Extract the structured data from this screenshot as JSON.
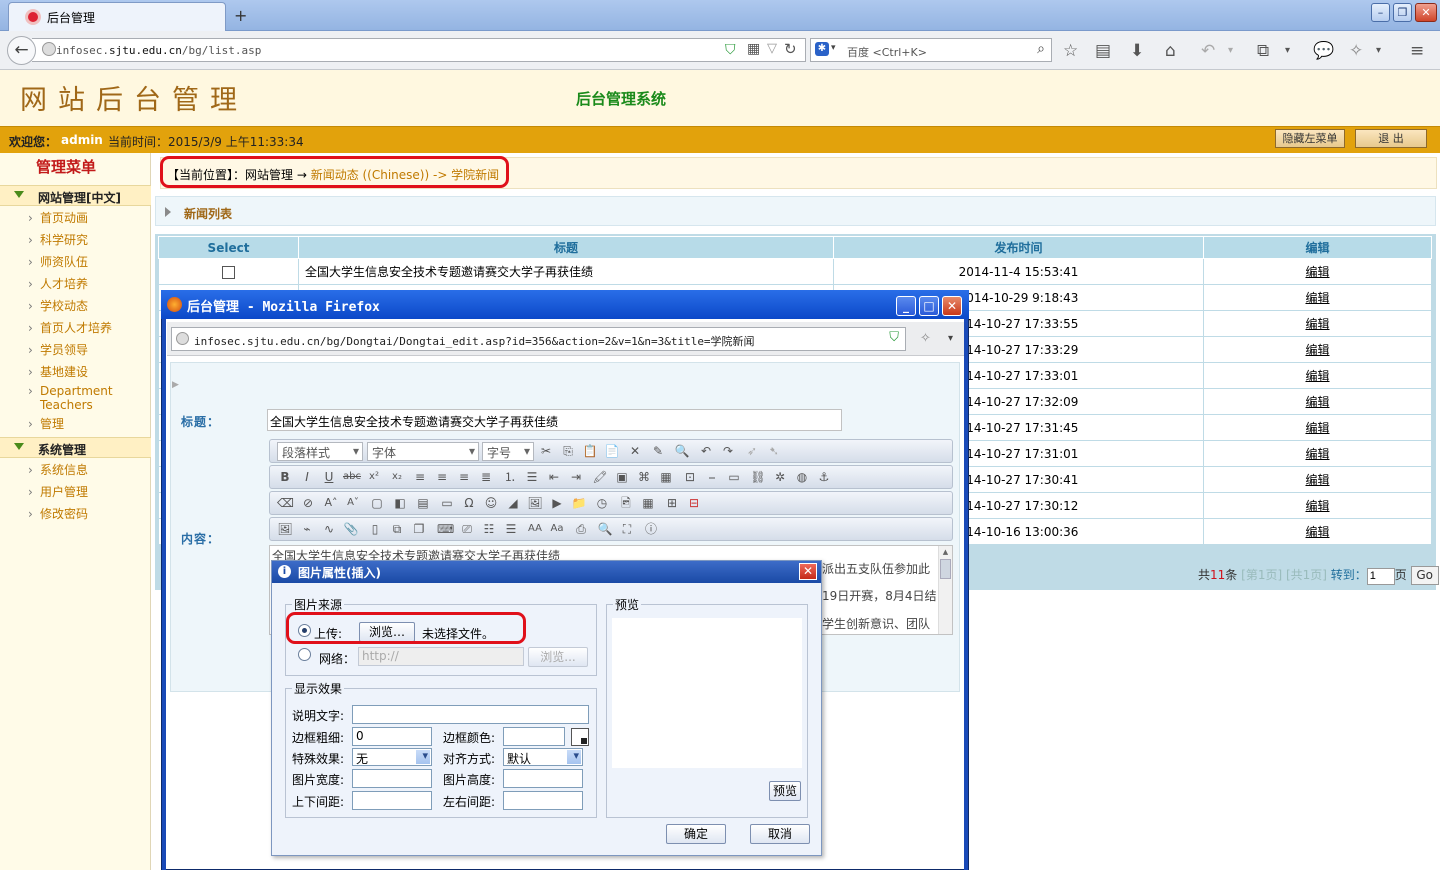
{
  "browser": {
    "tab_title": "后台管理",
    "new_tab_symbol": "+",
    "url_prefix": "infosec.",
    "url_domain": "sjtu.edu.cn",
    "url_path": "/bg/list.asp",
    "search_placeholder": "百度 <Ctrl+K>"
  },
  "header": {
    "site_title": "网站后台管理",
    "system_name": "后台管理系统"
  },
  "welcome": {
    "prefix": "欢迎您：",
    "user": "admin",
    "time_label": "当前时间：",
    "time": "2015/3/9 上午11:33:34",
    "hide_menu": "隐藏左菜单",
    "logout": "退 出"
  },
  "sidebar": {
    "title": "管理菜单",
    "section1": "网站管理[中文]",
    "items1": [
      "首页动画",
      "科学研究",
      "师资队伍",
      "人才培养",
      "学校动态",
      "首页人才培养",
      "学员领导",
      "基地建设"
    ],
    "dept_line1": "Department",
    "dept_line2": "Teachers",
    "item_manage": "管理",
    "section2": "系统管理",
    "items2": [
      "系统信息",
      "用户管理",
      "修改密码"
    ]
  },
  "breadcrumb": {
    "label": "【当前位置】：网站管理 → ",
    "path": "新闻动态 ((Chinese)) -> 学院新闻"
  },
  "list": {
    "bar_title": "新闻列表",
    "headers": [
      "Select",
      "标题",
      "发布时间",
      "编辑"
    ],
    "first_title": "全国大学生信息安全技术专题邀请赛交大学子再获佳绩",
    "first_time": "2014-11-4 15:53:41",
    "partial_times": [
      "2014-10-29 9:18:43",
      "014-10-27 17:33:55",
      "014-10-27 17:33:29",
      "014-10-27 17:33:01",
      "014-10-27 17:32:09",
      "014-10-27 17:31:45",
      "014-10-27 17:31:01",
      "014-10-27 17:30:41",
      "014-10-27 17:30:12",
      "014-10-16 13:00:36"
    ],
    "edit_label": "编辑"
  },
  "pager": {
    "total_prefix": "共",
    "total": "11",
    "total_suffix": "条",
    "page_info": "[第1页] [共1页]",
    "goto": "转到：",
    "page_value": "1",
    "page_unit": "页",
    "go": "Go"
  },
  "popup": {
    "title": "后台管理 - Mozilla Firefox",
    "url": "infosec.sjtu.edu.cn/bg/Dongtai/Dongtai_edit.asp?id=356&action=2&v=1&n=3&title=学院新闻",
    "title_label": "标题：",
    "title_value": "全国大学生信息安全技术专题邀请赛交大学子再获佳绩",
    "content_label": "内容：",
    "style_select": "段落样式",
    "font_select": "字体",
    "size_select": "字号",
    "content_line1": "全国大学生信息安全技术专题邀请赛交大学子再获佳绩",
    "content_frag1": "派出五支队伍参加此",
    "content_frag2": "19日开赛，8月4日结",
    "content_frag3": "学生创新意识、团队"
  },
  "dialog": {
    "title": "图片属性(插入)",
    "source_legend": "图片来源",
    "upload_label": "上传:",
    "browse_button": "浏览…",
    "no_file": "未选择文件。",
    "web_label": "网络：",
    "web_placeholder": "http://",
    "web_browse": "浏览...",
    "preview_legend": "预览",
    "effect_legend": "显示效果",
    "caption_label": "说明文字:",
    "border_width_label": "边框粗细:",
    "border_width_value": "0",
    "border_color_label": "边框颜色:",
    "special_label": "特殊效果:",
    "special_value": "无",
    "align_label": "对齐方式:",
    "align_value": "默认",
    "img_width_label": "图片宽度:",
    "img_height_label": "图片高度:",
    "vspace_label": "上下间距:",
    "hspace_label": "左右间距:",
    "preview_button": "预览",
    "ok_button": "确定",
    "cancel_button": "取消"
  },
  "colors": {
    "accent_orange": "#e2a20c",
    "highlight_red": "#e0101a",
    "table_header": "#b7dbe8"
  }
}
